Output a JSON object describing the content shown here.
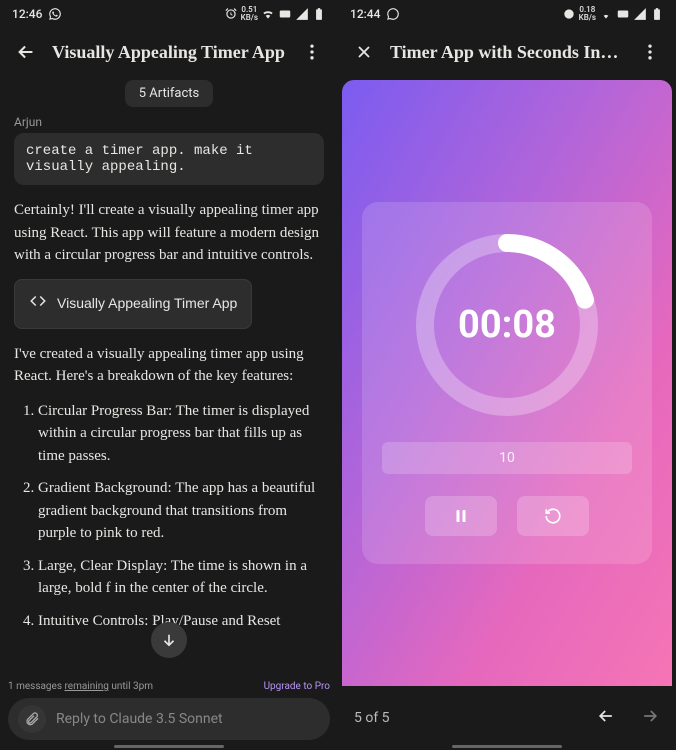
{
  "left": {
    "status": {
      "time": "12:46",
      "kbs": "0.51"
    },
    "title": "Visually Appealing Timer App",
    "artifacts_badge": "5 Artifacts",
    "user_name": "Arjun",
    "user_message": "create a timer app. make it visually appealing.",
    "intro": "Certainly! I'll create a visually appealing timer app using React. This app will feature a modern design with a circular progress bar and intuitive controls.",
    "artifact_link": "Visually Appealing Timer App",
    "breakdown_intro": "I've created a visually appealing timer app using React. Here's a breakdown of the key features:",
    "features": [
      "Circular Progress Bar: The timer is displayed within a circular progress bar that fills up as time passes.",
      "Gradient Background: The app has a beautiful gradient background that transitions from purple to pink to red.",
      "Large, Clear Display: The time is shown in a large, bold f         in the center of the circle.",
      "Intuitive Controls: Play/Pause and Reset"
    ],
    "footer": {
      "messages_pre": "1 messages ",
      "messages_u": "remaining",
      "messages_post": " until 3pm",
      "upgrade": "Upgrade to Pro"
    },
    "reply_placeholder": "Reply to Claude 3.5 Sonnet"
  },
  "right": {
    "status": {
      "time": "12:44",
      "kbs": "0.18"
    },
    "title": "Timer App with Seconds Input and Fi…",
    "timer": {
      "display": "00:08",
      "input_value": "10"
    },
    "footer": {
      "page": "5 of 5"
    }
  }
}
